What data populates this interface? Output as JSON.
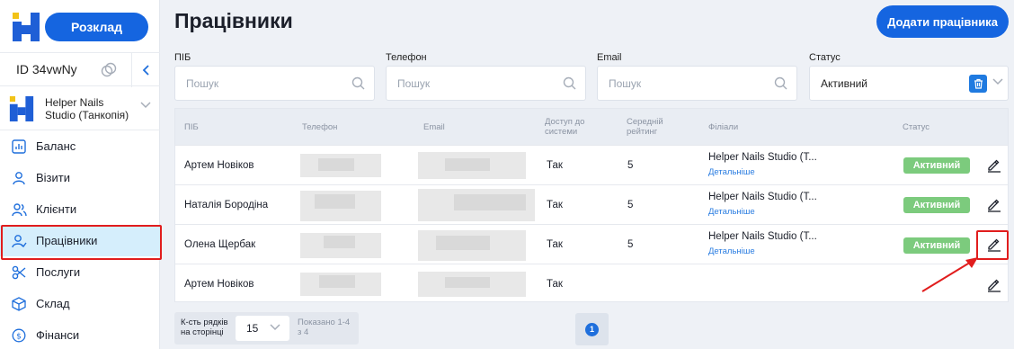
{
  "sidebar": {
    "schedule_label": "Розклад",
    "account_id": "ID 34vwNy",
    "studio_name": "Helper Nails Studio (Танкопія)",
    "items": [
      {
        "label": "Баланс",
        "icon": "chart-icon"
      },
      {
        "label": "Візити",
        "icon": "user-icon"
      },
      {
        "label": "Клієнти",
        "icon": "users-icon"
      },
      {
        "label": "Працівники",
        "icon": "staff-icon",
        "active": true
      },
      {
        "label": "Послуги",
        "icon": "scissors-icon"
      },
      {
        "label": "Склад",
        "icon": "box-icon"
      },
      {
        "label": "Фінанси",
        "icon": "dollar-icon"
      }
    ]
  },
  "header": {
    "title": "Працівники",
    "add_label": "Додати працівника"
  },
  "filters": {
    "name_label": "ПІБ",
    "phone_label": "Телефон",
    "email_label": "Email",
    "status_label": "Статус",
    "placeholder": "Пошук",
    "status_value": "Активний"
  },
  "table": {
    "headers": {
      "name": "ПІБ",
      "phone": "Телефон",
      "email": "Email",
      "access": "Доступ до системи",
      "rating": "Середній рейтинг",
      "branches": "Філіали",
      "status": "Статус"
    },
    "rows": [
      {
        "name": "Артем Новіков",
        "access": "Так",
        "rating": "5",
        "branch": "Helper Nails Studio (Т...",
        "more": "Детальніше",
        "status": "Активний"
      },
      {
        "name": "Наталія Бородіна",
        "access": "Так",
        "rating": "5",
        "branch": "Helper Nails Studio (Т...",
        "more": "Детальніше",
        "status": "Активний"
      },
      {
        "name": "Олена Щербак",
        "access": "Так",
        "rating": "5",
        "branch": "Helper Nails Studio (Т...",
        "more": "Детальніше",
        "status": "Активний"
      },
      {
        "name": "Артем Новіков",
        "access": "Так",
        "rating": "",
        "branch": "",
        "more": "",
        "status": ""
      }
    ]
  },
  "footer": {
    "rows_label": "К-сть рядків на сторінці",
    "rows_value": "15",
    "shown": "Показано 1-4 з 4",
    "page": "1"
  },
  "colors": {
    "accent": "#1565e0",
    "active_bg": "#d5eefc",
    "badge": "#7ccb7d",
    "highlight": "#e11d1d"
  }
}
